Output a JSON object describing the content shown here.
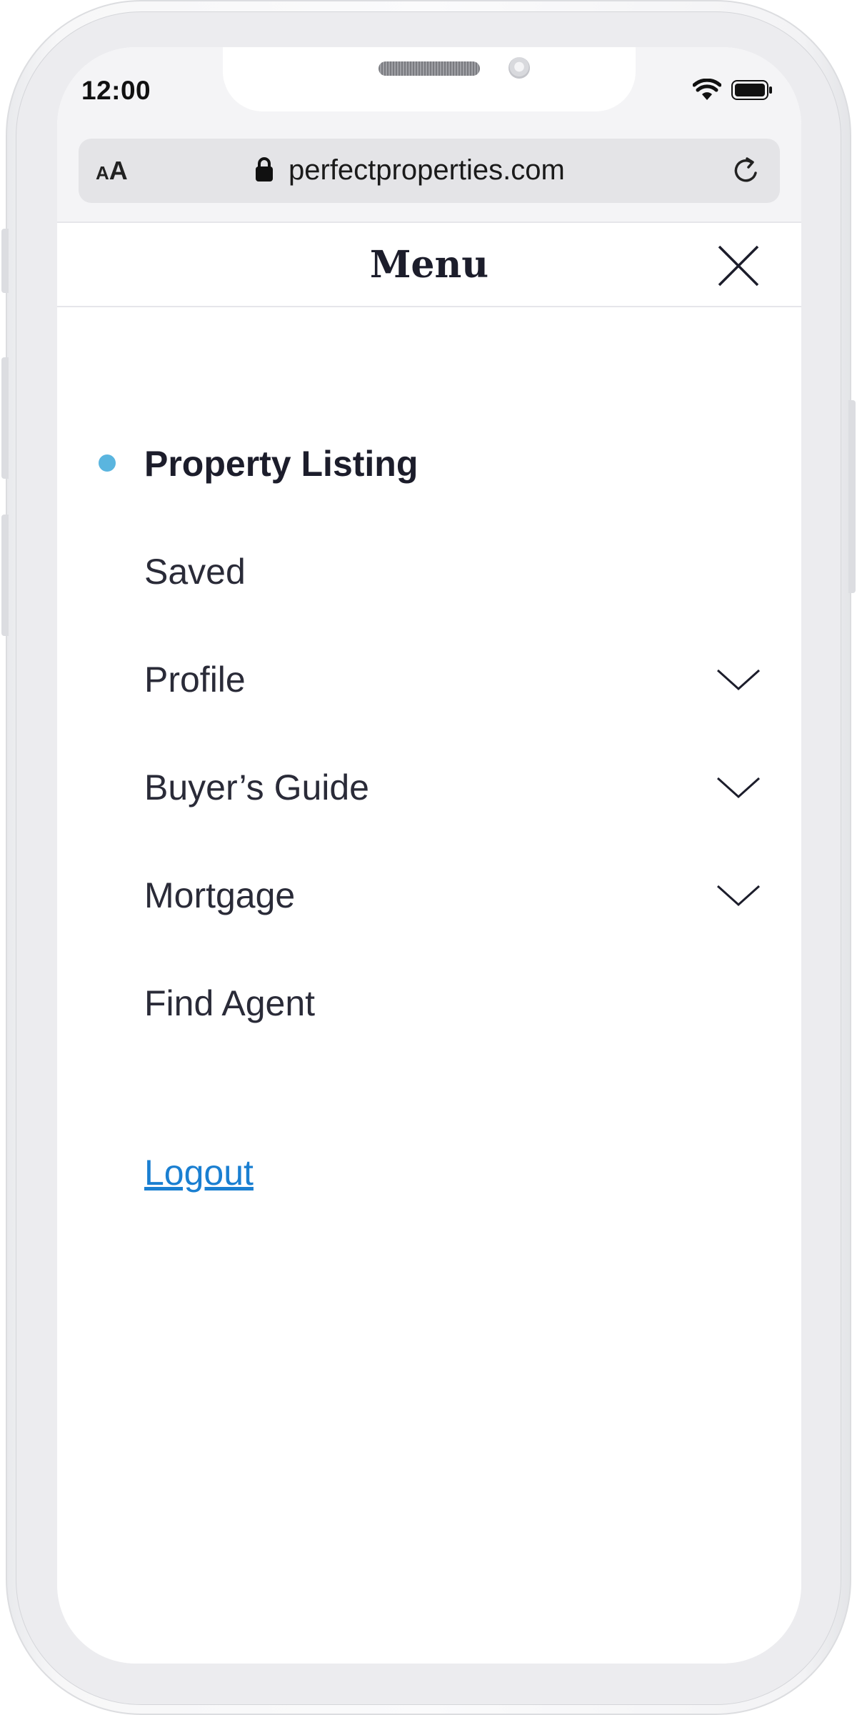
{
  "status_bar": {
    "time": "12:00",
    "wifi_icon": "wifi-icon",
    "battery_icon": "battery-icon"
  },
  "browser": {
    "text_size_small": "A",
    "text_size_large": "A",
    "url": "perfectproperties.com",
    "lock_icon": "lock-icon",
    "reload_icon": "reload-icon"
  },
  "menu": {
    "title": "Menu",
    "close_icon": "close-icon",
    "items": [
      {
        "label": "Property Listing",
        "active": true,
        "expandable": false
      },
      {
        "label": "Saved",
        "active": false,
        "expandable": false
      },
      {
        "label": "Profile",
        "active": false,
        "expandable": true
      },
      {
        "label": "Buyer’s Guide",
        "active": false,
        "expandable": true
      },
      {
        "label": "Mortgage",
        "active": false,
        "expandable": true
      },
      {
        "label": "Find Agent",
        "active": false,
        "expandable": false
      }
    ],
    "logout_label": "Logout"
  },
  "colors": {
    "accent_dot": "#5ab5df",
    "link": "#1a7fd1",
    "text": "#1c1d2b"
  }
}
